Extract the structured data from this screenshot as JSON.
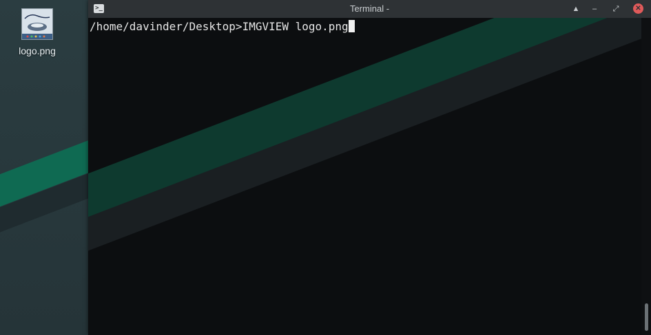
{
  "desktop": {
    "icons": [
      {
        "label": "logo.png",
        "icon": "image-thumbnail-icon"
      }
    ]
  },
  "window": {
    "title": "Terminal -",
    "app_icon": "terminal-icon",
    "buttons": {
      "shade": "▲",
      "minimize": "–",
      "maximize": "⤢",
      "close": "✕"
    }
  },
  "terminal": {
    "prompt": "/home/davinder/Desktop>",
    "command": "IMGVIEW logo.png"
  },
  "colors": {
    "wallpaper_green": "#0f6a52",
    "titlebar": "#2e3235",
    "close_button": "#e05a5a",
    "terminal_bg": "#0c0e10"
  }
}
